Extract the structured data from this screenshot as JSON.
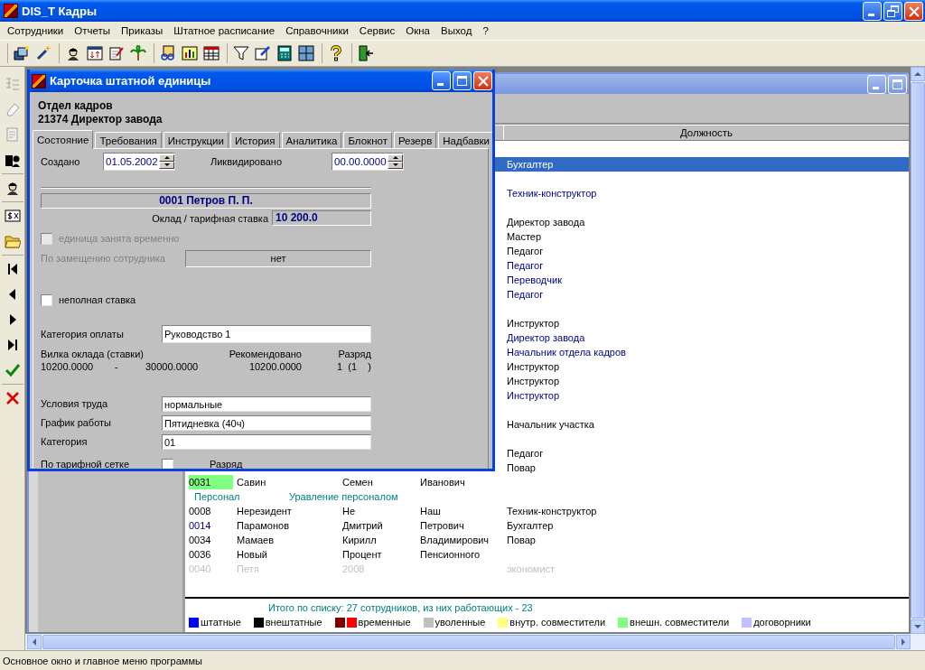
{
  "window": {
    "title": "DIS_T Кадры"
  },
  "menu": [
    "Сотрудники",
    "Отчеты",
    "Приказы",
    "Штатное расписание",
    "Справочники",
    "Сервис",
    "Окна",
    "Выход",
    "?"
  ],
  "list_window": {
    "header": "Должность",
    "rows": [
      {
        "kind": "group",
        "selected": false
      },
      {
        "kind": "employee",
        "position": "Бухгалтер",
        "selected": true
      },
      {
        "kind": "group",
        "selected": false
      },
      {
        "kind": "employee",
        "position": "Техник-конструктор",
        "color": "#000080",
        "selected": false
      },
      {
        "kind": "group",
        "selected": false
      },
      {
        "kind": "employee",
        "position": "Директор завода",
        "color": "#000000",
        "selected": false
      },
      {
        "kind": "employee",
        "position": "Мастер",
        "color": "#000000",
        "selected": false
      },
      {
        "kind": "employee",
        "position": "Педагог",
        "color": "#000000",
        "selected": false
      },
      {
        "kind": "employee",
        "position": "Педагог",
        "color": "#000080",
        "selected": false
      },
      {
        "kind": "employee",
        "position": "Переводчик",
        "color": "#000080",
        "selected": false
      },
      {
        "kind": "employee",
        "position": "Педагог",
        "color": "#000080",
        "selected": false
      },
      {
        "kind": "group",
        "selected": false
      },
      {
        "kind": "employee",
        "position": "Инструктор",
        "color": "#000000",
        "selected": false
      },
      {
        "kind": "employee",
        "position": "Директор завода",
        "color": "#000080",
        "selected": false
      },
      {
        "kind": "employee",
        "position": "Начальник отдела кадров",
        "color": "#000080",
        "selected": false
      },
      {
        "kind": "employee",
        "position": "Инструктор",
        "color": "#000000",
        "selected": false
      },
      {
        "kind": "employee",
        "position": "Инструктор",
        "color": "#000000",
        "selected": false
      },
      {
        "kind": "employee",
        "position": "Инструктор",
        "color": "#000080",
        "selected": false
      },
      {
        "kind": "group",
        "selected": false
      },
      {
        "kind": "employee",
        "position": "Начальник участка",
        "color": "#000000",
        "selected": false
      },
      {
        "kind": "group",
        "selected": false
      },
      {
        "kind": "employee",
        "position": "Педагог",
        "color": "#000000",
        "selected": false
      },
      {
        "kind": "employee",
        "position": "Повар",
        "color": "#000000",
        "selected": false
      },
      {
        "kind": "employee",
        "code": "0031",
        "code_mark": {
          "color": "#80ff80"
        },
        "surname": "Савин",
        "name": "Семен",
        "patronymic": "Иванович",
        "color": "#000000",
        "selected": false
      },
      {
        "kind": "group",
        "label": "Персонал",
        "sublabel": "Уравление персоналом",
        "selected": false
      },
      {
        "kind": "employee",
        "code": "0008",
        "surname": "Нерезидент",
        "name": "Не",
        "patronymic": "Наш",
        "position": "Техник-конструктор",
        "color": "#000000",
        "selected": false
      },
      {
        "kind": "employee",
        "code": "0014",
        "code_text": {
          "color": "#000080"
        },
        "surname": "Парамонов",
        "name": "Дмитрий",
        "patronymic": "Петрович",
        "position": "Бухгалтер",
        "color": "#000000",
        "selected": false
      },
      {
        "kind": "employee",
        "code": "0034",
        "surname": "Мамаев",
        "name": "Кирилл",
        "patronymic": "Владимирович",
        "position": "Повар",
        "color": "#000000",
        "selected": false
      },
      {
        "kind": "employee",
        "code": "0036",
        "surname": "Новый",
        "name": "Процент",
        "patronymic": "Пенсионного",
        "color": "#000000",
        "selected": false
      },
      {
        "kind": "employee",
        "code": "0040",
        "surname": "Петя",
        "name": "2008",
        "position": "экономист",
        "color": "#c0c0c0",
        "selected": false
      }
    ],
    "total": "Итого по списку: 27 сотрудников, из них работающих - 23",
    "legend": [
      {
        "label": "штатные",
        "swatches": [
          {
            "color": "#0000ff"
          }
        ]
      },
      {
        "label": "внештатные",
        "swatches": [
          {
            "color": "#000000"
          }
        ]
      },
      {
        "label": "временные",
        "swatches": [
          {
            "color": "#800000"
          },
          {
            "color": "#ff0000"
          }
        ]
      },
      {
        "label": "уволенные",
        "swatches": [
          {
            "color": "#c0c0c0"
          }
        ]
      },
      {
        "label": "внутр. совместители",
        "swatches": [
          {
            "color": "#ffff80"
          }
        ]
      },
      {
        "label": "внешн. совместители",
        "swatches": [
          {
            "color": "#80ff80"
          }
        ]
      },
      {
        "label": "договорники",
        "swatches": [
          {
            "color": "#c0c0ff"
          }
        ]
      }
    ]
  },
  "dialog": {
    "title": "Карточка штатной единицы",
    "department": "Отдел кадров",
    "unit": "21374 Директор завода",
    "tabs": [
      {
        "label": "Состояние",
        "selected": true
      },
      {
        "label": "Требования",
        "selected": false
      },
      {
        "label": "Инструкции",
        "selected": false
      },
      {
        "label": "История",
        "selected": false
      },
      {
        "label": "Аналитика",
        "selected": false
      },
      {
        "label": "Блокнот",
        "selected": false
      },
      {
        "label": "Резерв",
        "selected": false
      },
      {
        "label": "Надбавки",
        "selected": false
      }
    ],
    "created": {
      "label": "Создано",
      "value": "01.05.2002"
    },
    "liquidated": {
      "label": "Ликвидировано",
      "value": "00.00.0000"
    },
    "employee": "0001 Петров П. П.",
    "salary": {
      "label": "Оклад / тарифная ставка",
      "value": "10 200.0"
    },
    "temporary": {
      "label": "единица занята временно",
      "checked": false,
      "disabled": true
    },
    "substitution": {
      "label": "По замещению сотрудника",
      "value": "нет",
      "disabled": true
    },
    "part_time": {
      "label": "неполная ставка",
      "checked": false
    },
    "pay_category": {
      "label": "Категория оплаты",
      "value": "Руководство 1"
    },
    "salary_range": {
      "label": "Вилка оклада (ставки)",
      "recommended_label": "Рекомендовано",
      "grade_label": "Разряд",
      "min": "10200.0000",
      "dash": "-",
      "max": "30000.0000",
      "recommended": "10200.0000",
      "grade": "1  (1    )"
    },
    "conditions": {
      "label": "Условия труда",
      "value": "нормальные"
    },
    "schedule": {
      "label": "График работы",
      "value": "Пятидневка (40ч)"
    },
    "category": {
      "label": "Категория",
      "value": "01"
    },
    "tariff_grid": {
      "label": "По тарифной сетке",
      "checked": false,
      "grade_label": "Разряд"
    }
  },
  "status_bar": "Основное окно и главное меню программы"
}
